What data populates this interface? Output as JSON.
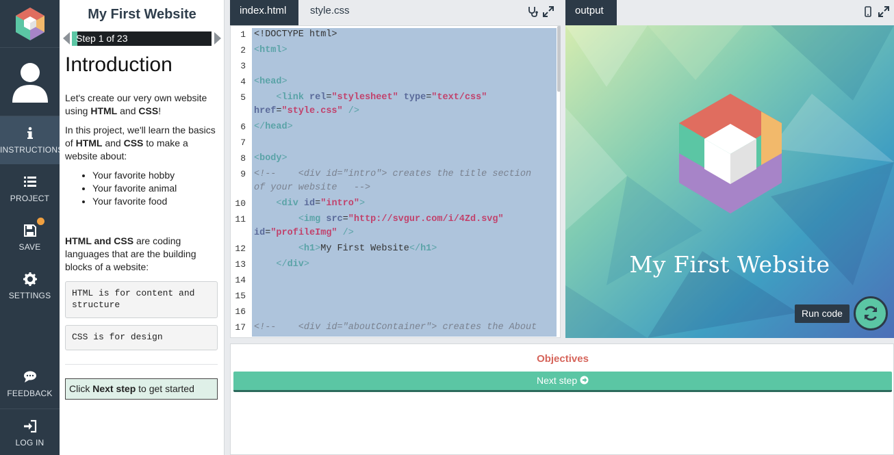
{
  "nav": {
    "items": [
      {
        "label": "INSTRUCTIONS",
        "icon": "info-icon",
        "active": true
      },
      {
        "label": "PROJECT",
        "icon": "list-icon"
      },
      {
        "label": "SAVE",
        "icon": "save-icon"
      },
      {
        "label": "SETTINGS",
        "icon": "gear-icon"
      },
      {
        "label": "FEEDBACK",
        "icon": "chat-icon"
      },
      {
        "label": "LOG IN",
        "icon": "sign-in-icon"
      }
    ]
  },
  "instructions": {
    "project_title": "My First Website",
    "step_text": "Step 1 of 23",
    "heading": "Introduction",
    "p1_a": "Let's create our very own website using ",
    "p1_b": "HTML",
    "p1_c": " and ",
    "p1_d": "CSS",
    "p1_e": "!",
    "p2_a": "In this project, we'll learn the basics of ",
    "p2_b": "HTML",
    "p2_c": " and ",
    "p2_d": "CSS",
    "p2_e": " to make a website about:",
    "list": [
      "Your favorite hobby",
      "Your favorite animal",
      "Your favorite food"
    ],
    "p3_a": "HTML and CSS",
    "p3_b": " are coding languages that are the building blocks of a website:",
    "box1": "HTML is for content and structure",
    "box2": "CSS is for design",
    "tip_a": "Click ",
    "tip_b": "Next step",
    "tip_c": " to get started"
  },
  "editor": {
    "tabs": [
      "index.html",
      "style.css"
    ],
    "line_numbers": [
      "1",
      "2",
      "3",
      "4",
      "5",
      "6",
      "7",
      "8",
      "9",
      "10",
      "11",
      "12",
      "13",
      "14",
      "15",
      "16",
      "17"
    ]
  },
  "output": {
    "tab": "output",
    "site_title": "My First Website",
    "run_label": "Run code"
  },
  "bottom": {
    "objectives": "Objectives",
    "next_step": "Next step"
  },
  "colors": {
    "nav_bg": "#2c3a47",
    "accent": "#5bc6a4",
    "objectives": "#d6655b"
  }
}
